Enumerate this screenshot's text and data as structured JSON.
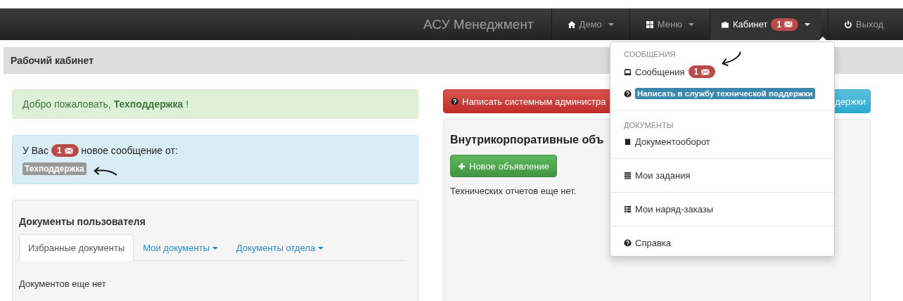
{
  "navbar": {
    "brand": "АСУ Менеджмент",
    "items": [
      {
        "label": "Демо",
        "caret": true,
        "selected": false
      },
      {
        "label": "Меню",
        "caret": true,
        "selected": false
      },
      {
        "label": "Кабинет",
        "caret": true,
        "selected": true,
        "badge": "1"
      },
      {
        "label": "Выход",
        "caret": false,
        "selected": false
      }
    ]
  },
  "page_title": "Рабочий кабинет",
  "welcome": {
    "text": "Добро пожаловать, **Техподдержка** !"
  },
  "notice": {
    "prefix": "У Вас",
    "badge": "1",
    "suffix": "новое сообщение от:",
    "sender": "Техподдержка"
  },
  "documents": {
    "title": "Документы пользователя",
    "tabs": [
      {
        "label": "Избранные документы",
        "selected": true,
        "caret": false
      },
      {
        "label": "Мои документы",
        "selected": false,
        "caret": true
      },
      {
        "label": "Документы отдела",
        "selected": false,
        "caret": true
      }
    ],
    "empty": "Документов еще нет"
  },
  "actions": [
    {
      "label": "Написать системным администра",
      "kind": "danger"
    },
    {
      "label": "держки",
      "kind": "info"
    }
  ],
  "announcements": {
    "title": "Внутрикорпоративные объ",
    "button": "Новое объявление",
    "empty": "Технических отчетов еще нет."
  },
  "dropdown": {
    "sections": [
      {
        "header": "СООБЩЕНИЯ",
        "items": [
          {
            "label": "Сообщения",
            "kind": "plain",
            "badge": "1"
          },
          {
            "label": "Написать в службу технической поддержки",
            "kind": "label"
          }
        ]
      },
      {
        "header": "ДОКУМЕНТЫ",
        "items": [
          {
            "label": "Документооборот",
            "kind": "plain"
          }
        ]
      },
      {
        "items": [
          {
            "label": "Мои задания",
            "kind": "plain"
          }
        ]
      },
      {
        "items": [
          {
            "label": "Мои наряд-заказы",
            "kind": "plain"
          }
        ]
      },
      {
        "items": [
          {
            "label": "Справка",
            "kind": "plain"
          }
        ]
      }
    ]
  }
}
